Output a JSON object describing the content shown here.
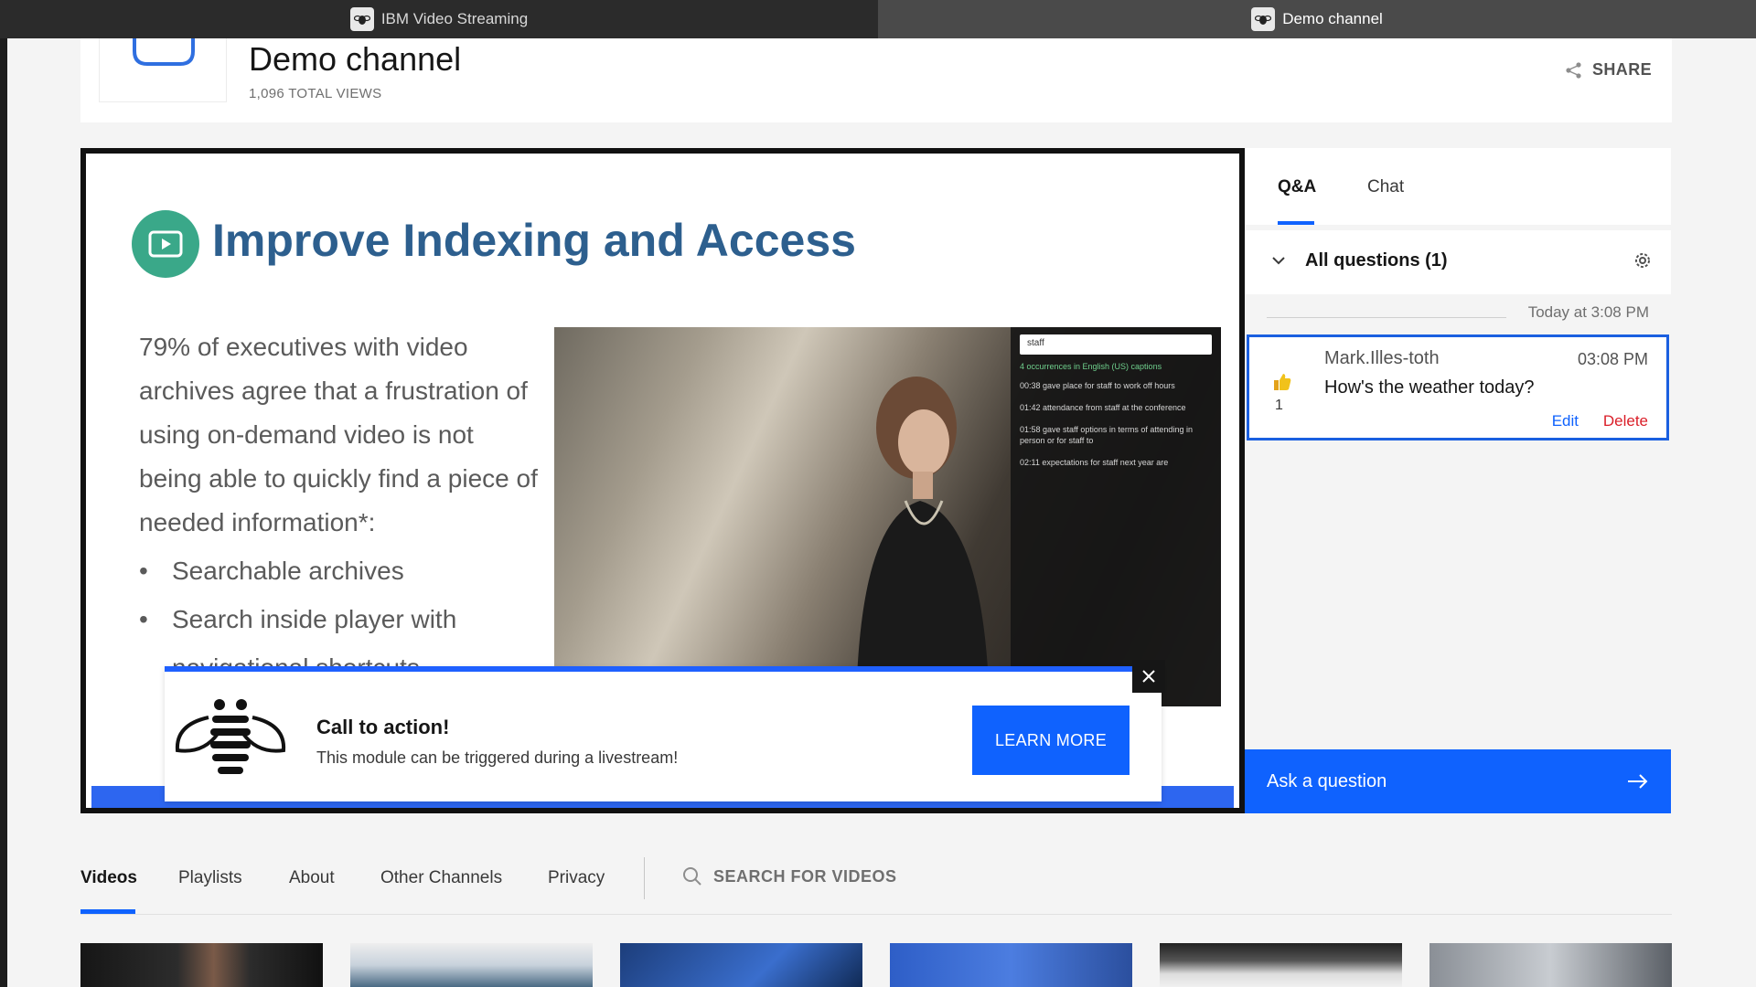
{
  "browser": {
    "tabs": [
      {
        "label": "IBM Video Streaming",
        "active": false
      },
      {
        "label": "Demo channel",
        "active": true
      }
    ]
  },
  "channel": {
    "title": "Demo channel",
    "views": "1,096 TOTAL VIEWS",
    "share_label": "SHARE"
  },
  "slide": {
    "title": "Improve Indexing and Access",
    "body": "79% of executives with video archives agree that a frustration of using on-demand video is not being able to quickly find a piece of needed information*:",
    "bullets": [
      "Searchable archives",
      "Search inside player with navigational shortcuts"
    ],
    "search_overlay": {
      "query": "staff",
      "result_summary": "4 occurrences in English (US) captions",
      "results": [
        "00:38  gave place for staff to work off hours",
        "01:42  attendance from staff at the conference",
        "01:58  gave staff options in terms of attending in person or for staff to",
        "02:11  expectations for staff next year are"
      ]
    }
  },
  "cta": {
    "title": "Call to action!",
    "text": "This module can be triggered during a livestream!",
    "button_label": "LEARN MORE"
  },
  "qa": {
    "tabs": [
      {
        "label": "Q&A",
        "active": true
      },
      {
        "label": "Chat",
        "active": false
      }
    ],
    "filter_label": "All questions (1)",
    "date_separator": "Today at 3:08 PM",
    "questions": [
      {
        "author": "Mark.Illes-toth",
        "time": "03:08 PM",
        "text": "How's the weather today?",
        "likes": "1",
        "edit_label": "Edit",
        "delete_label": "Delete"
      }
    ],
    "ask_label": "Ask a question"
  },
  "bottom_nav": {
    "items": [
      {
        "label": "Videos",
        "active": true
      },
      {
        "label": "Playlists",
        "active": false
      },
      {
        "label": "About",
        "active": false
      },
      {
        "label": "Other Channels",
        "active": false
      },
      {
        "label": "Privacy",
        "active": false
      }
    ],
    "search_placeholder": "SEARCH FOR VIDEOS"
  },
  "colors": {
    "accent": "#0f62fe",
    "delete": "#da1e28",
    "slide_title": "#2d5f8e",
    "slide_icon": "#3aa889"
  }
}
